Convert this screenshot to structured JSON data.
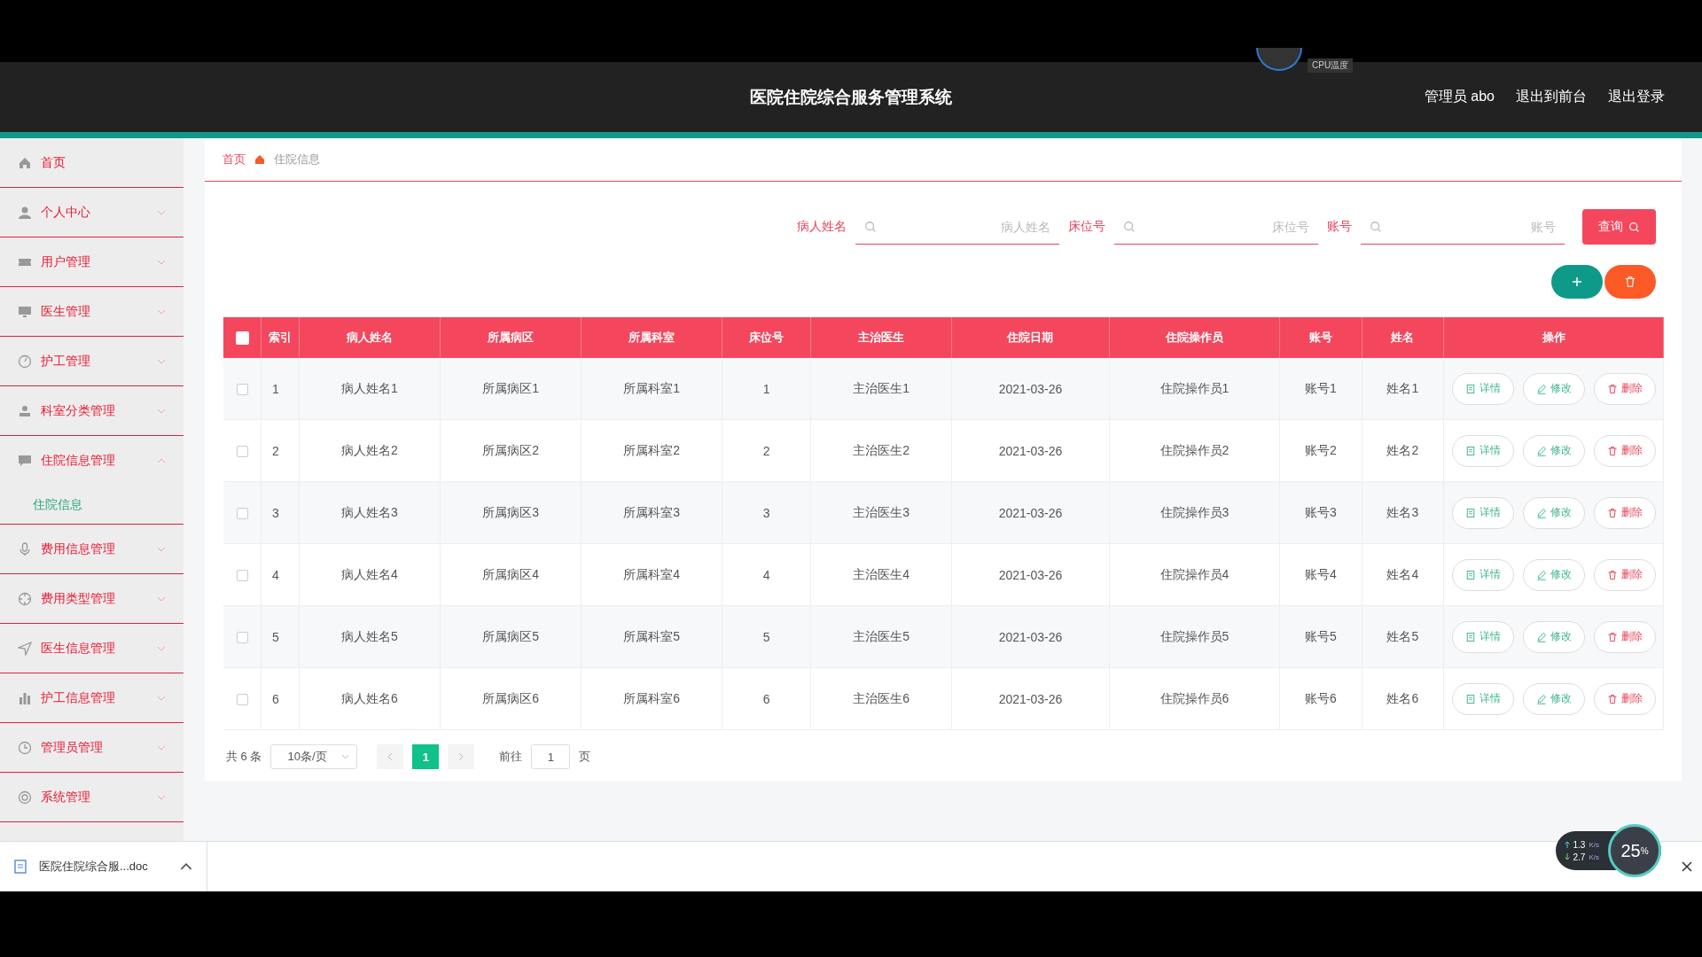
{
  "header": {
    "title": "医院住院综合服务管理系统",
    "user": "管理员 abo",
    "links": [
      "退出到前台",
      "退出登录"
    ],
    "cpu_label": "CPU温度"
  },
  "sidebar": {
    "items": [
      {
        "label": "首页",
        "kind": "link"
      },
      {
        "label": "个人中心",
        "kind": "menu",
        "expanded": false
      },
      {
        "label": "用户管理",
        "kind": "menu",
        "expanded": false
      },
      {
        "label": "医生管理",
        "kind": "menu",
        "expanded": false
      },
      {
        "label": "护工管理",
        "kind": "menu",
        "expanded": false
      },
      {
        "label": "科室分类管理",
        "kind": "menu",
        "expanded": false
      },
      {
        "label": "住院信息管理",
        "kind": "menu",
        "expanded": true,
        "children": [
          {
            "label": "住院信息",
            "selected": true
          }
        ]
      },
      {
        "label": "费用信息管理",
        "kind": "menu",
        "expanded": false
      },
      {
        "label": "费用类型管理",
        "kind": "menu",
        "expanded": false
      },
      {
        "label": "医生信息管理",
        "kind": "menu",
        "expanded": false
      },
      {
        "label": "护工信息管理",
        "kind": "menu",
        "expanded": false
      },
      {
        "label": "管理员管理",
        "kind": "menu",
        "expanded": false
      },
      {
        "label": "系统管理",
        "kind": "menu",
        "expanded": false
      }
    ]
  },
  "breadcrumb": [
    "首页",
    "住院信息"
  ],
  "search": {
    "fields": [
      {
        "label": "病人姓名",
        "placeholder": "病人姓名"
      },
      {
        "label": "床位号",
        "placeholder": "床位号"
      },
      {
        "label": "账号",
        "placeholder": "账号"
      }
    ],
    "button": "查询"
  },
  "table": {
    "columns": [
      "索引",
      "病人姓名",
      "所属病区",
      "所属科室",
      "床位号",
      "主治医生",
      "住院日期",
      "住院操作员",
      "账号",
      "姓名",
      "操作"
    ],
    "all_checked": false,
    "rows": [
      {
        "checked": false,
        "cells": [
          "1",
          "病人姓名1",
          "所属病区1",
          "所属科室1",
          "1",
          "主治医生1",
          "2021-03-26",
          "住院操作员1",
          "账号1",
          "姓名1"
        ],
        "actions": [
          "详情",
          "修改",
          "删除"
        ]
      },
      {
        "checked": false,
        "cells": [
          "2",
          "病人姓名2",
          "所属病区2",
          "所属科室2",
          "2",
          "主治医生2",
          "2021-03-26",
          "住院操作员2",
          "账号2",
          "姓名2"
        ],
        "actions": [
          "详情",
          "修改",
          "删除"
        ]
      },
      {
        "checked": false,
        "cells": [
          "3",
          "病人姓名3",
          "所属病区3",
          "所属科室3",
          "3",
          "主治医生3",
          "2021-03-26",
          "住院操作员3",
          "账号3",
          "姓名3"
        ],
        "actions": [
          "详情",
          "修改",
          "删除"
        ]
      },
      {
        "checked": false,
        "cells": [
          "4",
          "病人姓名4",
          "所属病区4",
          "所属科室4",
          "4",
          "主治医生4",
          "2021-03-26",
          "住院操作员4",
          "账号4",
          "姓名4"
        ],
        "actions": [
          "详情",
          "修改",
          "删除"
        ]
      },
      {
        "checked": false,
        "cells": [
          "5",
          "病人姓名5",
          "所属病区5",
          "所属科室5",
          "5",
          "主治医生5",
          "2021-03-26",
          "住院操作员5",
          "账号5",
          "姓名5"
        ],
        "actions": [
          "详情",
          "修改",
          "删除"
        ]
      },
      {
        "checked": false,
        "cells": [
          "6",
          "病人姓名6",
          "所属病区6",
          "所属科室6",
          "6",
          "主治医生6",
          "2021-03-26",
          "住院操作员6",
          "账号6",
          "姓名6"
        ],
        "actions": [
          "详情",
          "修改",
          "删除"
        ]
      }
    ]
  },
  "pagination": {
    "total": "共 6 条",
    "page_size": "10条/页",
    "pages": [
      {
        "label": "1",
        "selected": true
      }
    ],
    "goto_label": "前往",
    "goto_value": "1",
    "goto_suffix": "页"
  },
  "download_bar": {
    "file": "医院住院综合服...doc"
  },
  "net_widget": {
    "up": "1.3",
    "up_unit": "K/s",
    "down": "2.7",
    "down_unit": "K/s",
    "percent": "25",
    "percent_unit": "%"
  }
}
